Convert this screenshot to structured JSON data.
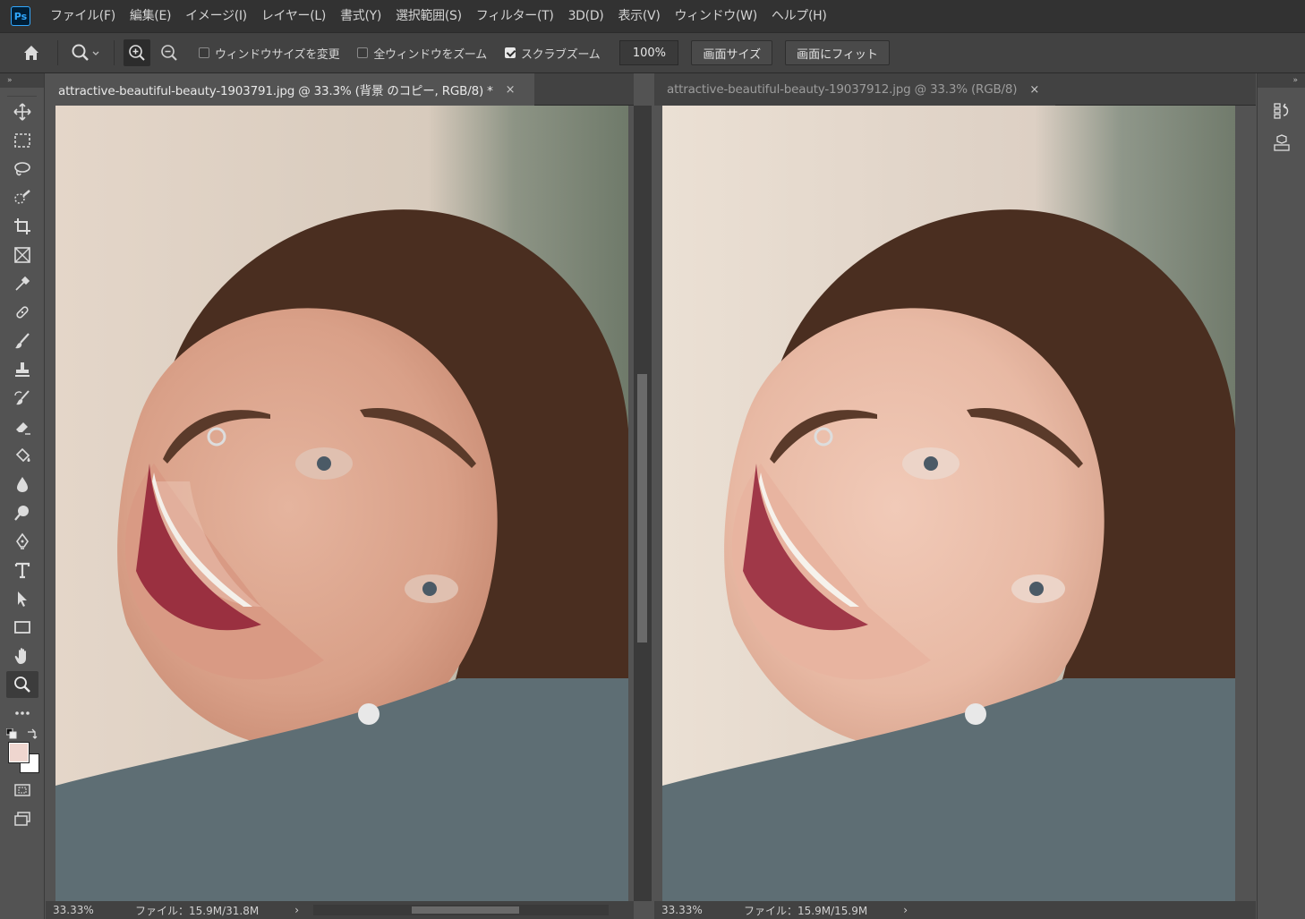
{
  "app": {
    "logo": "Ps",
    "menu": [
      "ファイル(F)",
      "編集(E)",
      "イメージ(I)",
      "レイヤー(L)",
      "書式(Y)",
      "選択範囲(S)",
      "フィルター(T)",
      "3D(D)",
      "表示(V)",
      "ウィンドウ(W)",
      "ヘルプ(H)"
    ]
  },
  "options_bar": {
    "home_icon": "home-icon",
    "tool_preset_icon": "zoom-tool-icon",
    "zoom_in_icon": "zoom-in-icon",
    "zoom_out_icon": "zoom-out-icon",
    "resize_windows_label": "ウィンドウサイズを変更",
    "resize_windows_checked": false,
    "zoom_all_label": "全ウィンドウをズーム",
    "zoom_all_checked": false,
    "scrubby_zoom_label": "スクラブズーム",
    "scrubby_zoom_checked": true,
    "zoom_value": "100%",
    "fit_screen_label": "画面サイズ",
    "fill_screen_label": "画面にフィット"
  },
  "toolbar": {
    "collapse": "»",
    "tools": [
      {
        "name": "move-tool-icon"
      },
      {
        "name": "marquee-tool-icon"
      },
      {
        "name": "lasso-tool-icon"
      },
      {
        "name": "quick-select-tool-icon"
      },
      {
        "name": "crop-tool-icon"
      },
      {
        "name": "frame-tool-icon"
      },
      {
        "name": "eyedropper-tool-icon"
      },
      {
        "name": "healing-brush-tool-icon"
      },
      {
        "name": "brush-tool-icon"
      },
      {
        "name": "stamp-tool-icon"
      },
      {
        "name": "history-brush-tool-icon"
      },
      {
        "name": "eraser-tool-icon"
      },
      {
        "name": "paint-bucket-tool-icon"
      },
      {
        "name": "blur-tool-icon"
      },
      {
        "name": "dodge-tool-icon"
      },
      {
        "name": "pen-tool-icon"
      },
      {
        "name": "type-tool-icon"
      },
      {
        "name": "path-select-tool-icon"
      },
      {
        "name": "rectangle-tool-icon"
      },
      {
        "name": "hand-tool-icon"
      },
      {
        "name": "zoom-tool-icon",
        "selected": true
      },
      {
        "name": "more-tools-icon"
      }
    ],
    "foreground_color": "#efd6cf",
    "background_color": "#ffffff"
  },
  "documents": [
    {
      "tab_label": "attractive-beautiful-beauty-1903791.jpg  @ 33.3% (背景 のコピー, RGB/8) *",
      "close": "×",
      "active": true,
      "zoom_status": "33.33%",
      "file_status": "ファイル：15.9M/31.8M"
    },
    {
      "tab_label": "attractive-beautiful-beauty-19037912.jpg @ 33.3% (RGB/8)",
      "close": "×",
      "active": false,
      "zoom_status": "33.33%",
      "file_status": "ファイル：15.9M/15.9M"
    }
  ],
  "status_arrow": "›",
  "colors": {
    "menubar": "#323232",
    "optbar": "#424242",
    "panel": "#535353",
    "accent": "#31a8ff"
  }
}
